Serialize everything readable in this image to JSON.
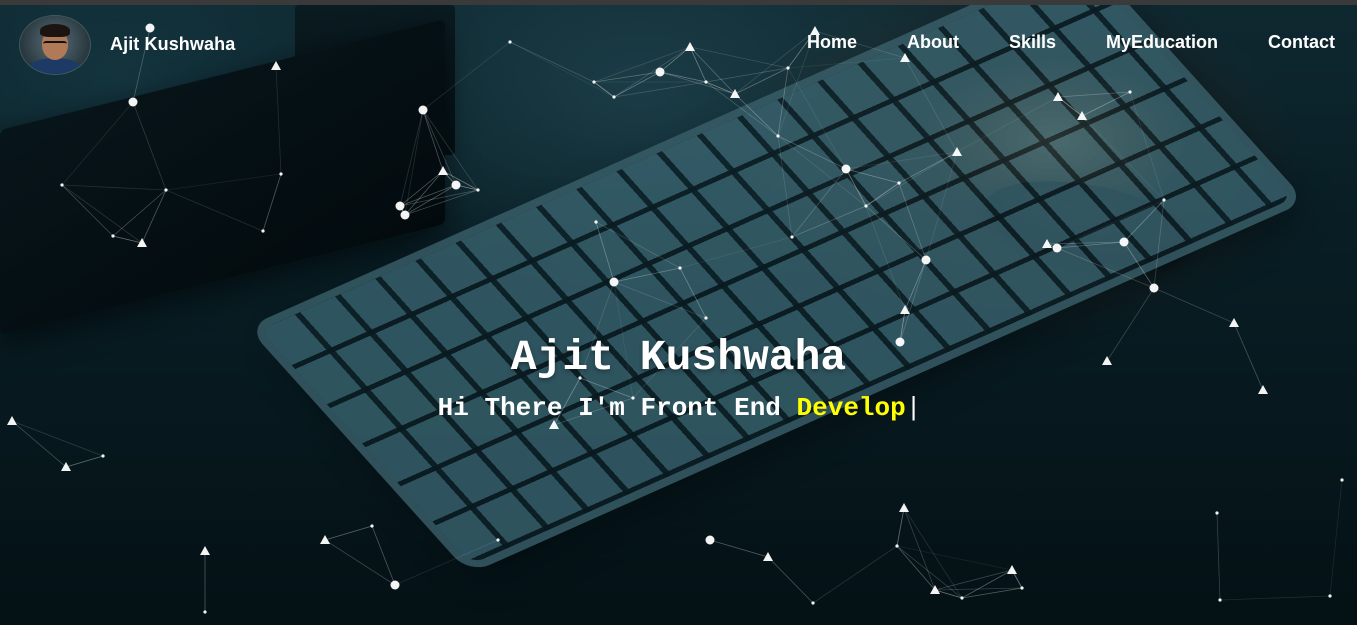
{
  "brand": {
    "name": "Ajit Kushwaha",
    "avatar_icon": "profile-photo"
  },
  "nav": {
    "links": [
      {
        "label": "Home"
      },
      {
        "label": "About"
      },
      {
        "label": "Skills"
      },
      {
        "label": "MyEducation"
      },
      {
        "label": "Contact"
      }
    ]
  },
  "hero": {
    "title": "Ajit Kushwaha",
    "subtitle_prefix": "Hi There I'm Front End ",
    "subtitle_typed": "Develop",
    "cursor": "|"
  },
  "colors": {
    "highlight": "#ffff00",
    "text": "#ffffff"
  }
}
